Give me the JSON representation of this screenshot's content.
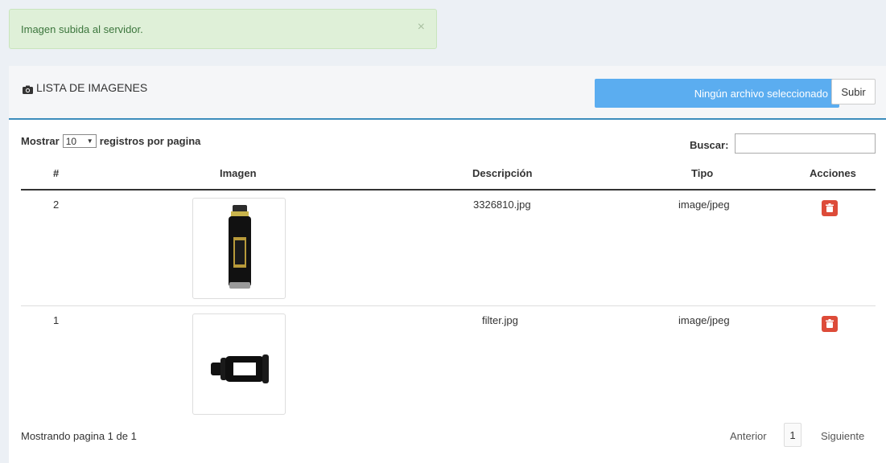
{
  "alert": {
    "message": "Imagen subida al servidor.",
    "close": "×"
  },
  "header": {
    "title": "LISTA DE IMAGENES",
    "icon": "camera-icon"
  },
  "upload": {
    "file_status": "Ningún archivo seleccionado",
    "button": "Subir"
  },
  "controls": {
    "show_prefix": "Mostrar",
    "page_size": "10",
    "show_suffix": "registros por pagina",
    "search_label": "Buscar:",
    "search_value": ""
  },
  "table": {
    "columns": [
      "#",
      "Imagen",
      "Descripción",
      "Tipo",
      "Acciones"
    ],
    "rows": [
      {
        "id": "2",
        "thumbnail": "spray-can-image",
        "description": "3326810.jpg",
        "type": "image/jpeg",
        "action": "trash-icon"
      },
      {
        "id": "1",
        "thumbnail": "filter-image",
        "description": "filter.jpg",
        "type": "image/jpeg",
        "action": "trash-icon"
      }
    ]
  },
  "footer": {
    "info": "Mostrando pagina 1 de 1",
    "prev": "Anterior",
    "page": "1",
    "next": "Siguiente"
  },
  "colors": {
    "alert_bg": "#dff0d8",
    "alert_text": "#3c763d",
    "file_area": "#5badf0",
    "header_accent": "#3c8dbc",
    "delete": "#dd4b39"
  }
}
